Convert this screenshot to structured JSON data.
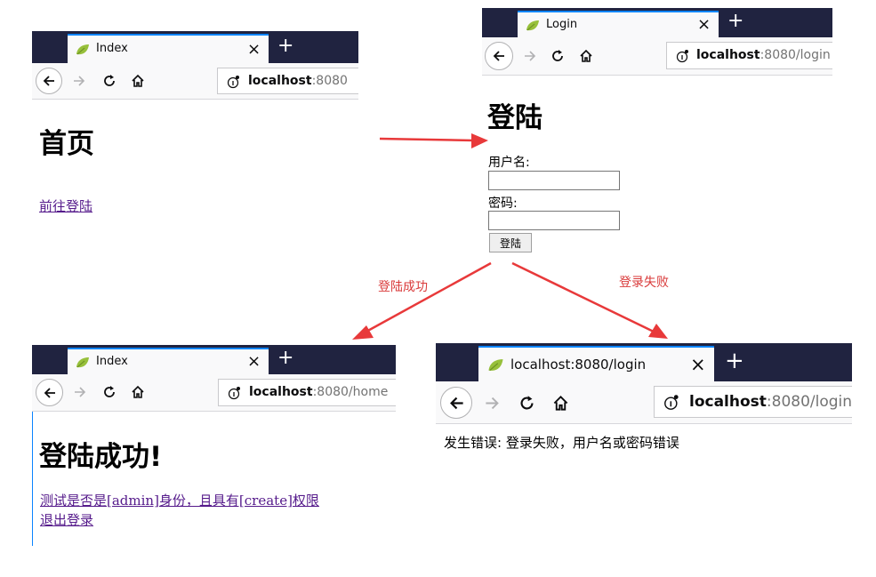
{
  "colors": {
    "tabbar": "#202340",
    "accent": "#0a84ff",
    "arrow": "#e8393a",
    "link": "#551a8b",
    "leaf": "#97c03b"
  },
  "icons": {
    "tab_favicon": "leaf-icon",
    "back": "back-arrow-icon",
    "forward": "forward-arrow-icon",
    "reload": "reload-icon",
    "home": "home-icon",
    "site_info": "info-icon",
    "close_tab": "close-icon",
    "new_tab": "plus-icon"
  },
  "windows": {
    "index": {
      "tab_title": "Index",
      "close": "×",
      "newtab": "+",
      "url_host": "localhost",
      "url_rest": ":8080",
      "heading": "首页",
      "link": "前往登陆"
    },
    "login": {
      "tab_title": "Login",
      "close": "×",
      "newtab": "+",
      "url_host": "localhost",
      "url_rest": ":8080/login",
      "heading": "登陆",
      "username_label": "用户名:",
      "password_label": "密码:",
      "username_value": "",
      "password_value": "",
      "submit_label": "登陆"
    },
    "home": {
      "tab_title": "Index",
      "close": "×",
      "newtab": "+",
      "url_host": "localhost",
      "url_rest": ":8080/home",
      "heading": "登陆成功!",
      "link1": "测试是否是[admin]身份，且具有[create]权限",
      "link2": "退出登录"
    },
    "error": {
      "tab_title": "localhost:8080/login",
      "close": "×",
      "newtab": "+",
      "url_host": "localhost",
      "url_rest": ":8080/login",
      "message": "发生错误: 登录失败，用户名或密码错误"
    }
  },
  "arrows": {
    "success_label": "登陆成功",
    "failure_label": "登录失败"
  }
}
